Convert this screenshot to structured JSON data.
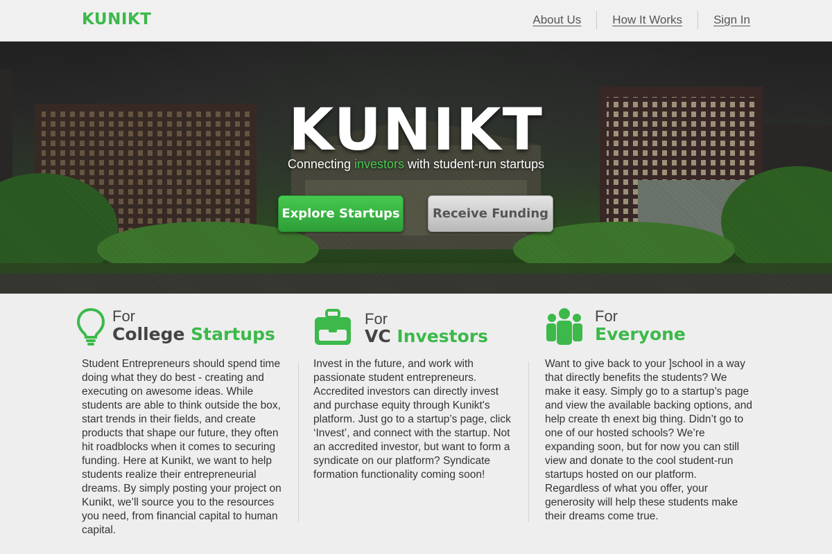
{
  "nav": {
    "logo": "KUNIKT",
    "links": [
      "About Us",
      "How It Works",
      "Sign In"
    ]
  },
  "hero": {
    "title": "KUNIKT",
    "subtitle_pre": "Connecting ",
    "subtitle_accent": "investors",
    "subtitle_post": " with student-run startups",
    "primary_button": "Explore Startups",
    "secondary_button": "Receive Funding"
  },
  "columns": [
    {
      "icon": "lightbulb-icon",
      "for_label": "For",
      "title_plain": "College ",
      "title_accent": "Startups",
      "body": "Student Entrepreneurs should spend time doing what they do best - creating and executing on awesome ideas. While students are able to think outside the box, start trends in their fields, and create products that shape our future, they often hit roadblocks when it comes to securing funding. Here at Kunikt, we want to help students realize their entrepreneurial dreams. By simply posting your project on Kunikt, we’ll source you to the resources you need, from financial capital to human capital."
    },
    {
      "icon": "briefcase-icon",
      "for_label": "For",
      "title_plain": "VC ",
      "title_accent": "Investors",
      "body": "Invest in the future, and work with passionate student entrepreneurs. Accredited investors can directly invest and purchase equity through Kunikt's platform. Just go to a startup’s page, click ‘Invest’,  and connect with the startup. Not an accredited investor, but want to form a syndicate on our platform? Syndicate formation functionality coming soon!"
    },
    {
      "icon": "group-icon",
      "for_label": "For",
      "title_plain": "",
      "title_accent": "Everyone",
      "body": "Want to give back to your ]school in a way that directly benefits the students? We make it easy. Simply go to a startup’s page and view the available backing options, and help create th enext big thing. Didn’t go to one of our hosted schools? We’re expanding soon, but for now you can still view and donate to the cool student-run startups hosted on our platform. Regardless of what you offer, your generosity will help these students make their dreams come true."
    }
  ],
  "colors": {
    "accent": "#3cb94a",
    "nav_bg": "#f0f0f0",
    "body_bg": "#eeeeee",
    "secondary_button": "#c4c4c4"
  }
}
